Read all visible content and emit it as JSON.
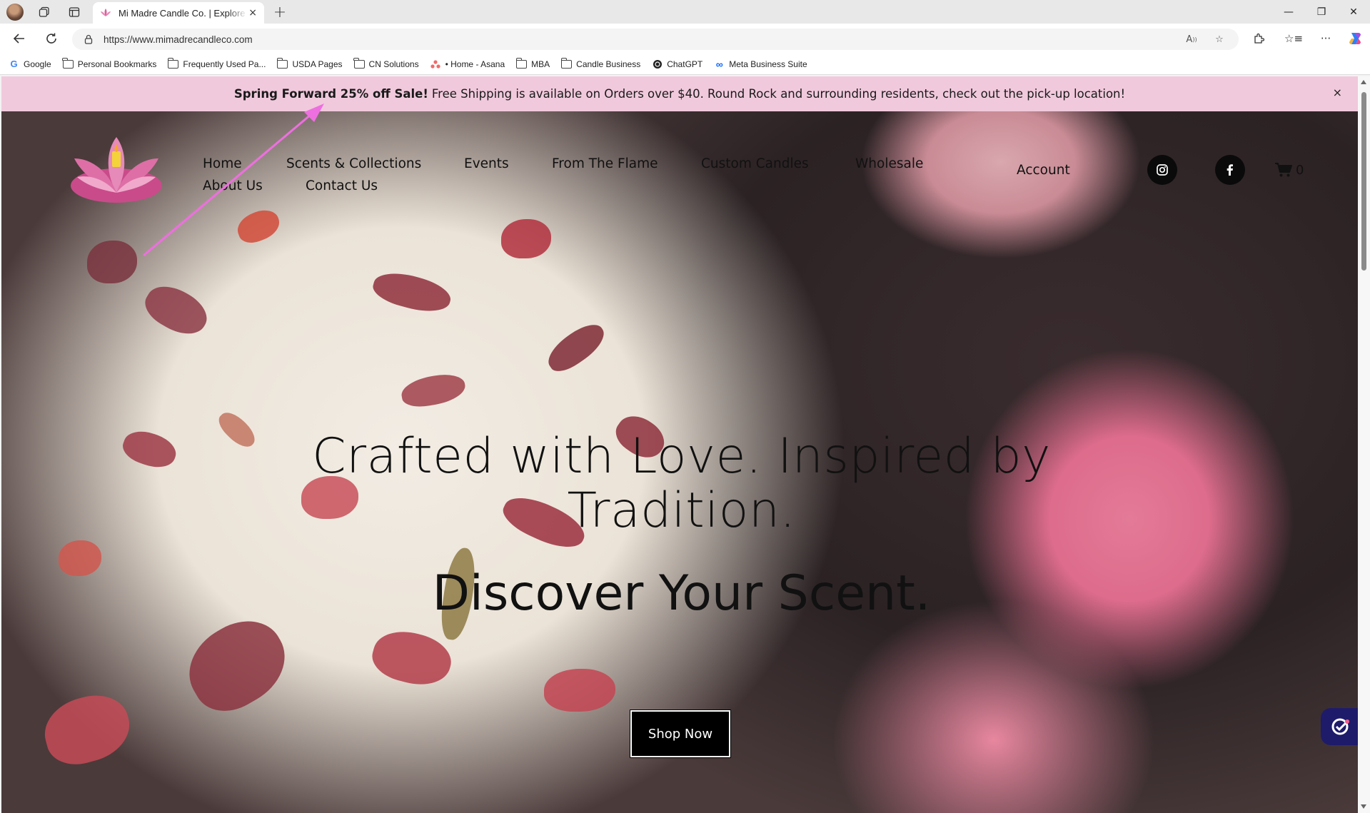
{
  "browser": {
    "tab": {
      "title": "Mi Madre Candle Co. | Explore Ha",
      "close": "×"
    },
    "new_tab": "+",
    "window_controls": {
      "minimize": "—",
      "restore": "❐",
      "close": "✕"
    },
    "address": {
      "url": "https://www.mimadrecandleco.com"
    },
    "bookmarks": [
      {
        "label": "Google",
        "icon": "google-icon"
      },
      {
        "label": "Personal Bookmarks",
        "icon": "folder-icon"
      },
      {
        "label": "Frequently Used Pa...",
        "icon": "folder-icon"
      },
      {
        "label": "USDA Pages",
        "icon": "folder-icon"
      },
      {
        "label": "CN Solutions",
        "icon": "folder-icon"
      },
      {
        "label": "• Home - Asana",
        "icon": "asana-icon"
      },
      {
        "label": "MBA",
        "icon": "folder-icon"
      },
      {
        "label": "Candle Business",
        "icon": "folder-icon"
      },
      {
        "label": "ChatGPT",
        "icon": "chatgpt-icon"
      },
      {
        "label": "Meta Business Suite",
        "icon": "meta-icon"
      }
    ]
  },
  "promo": {
    "bold": "Spring Forward 25% off Sale!",
    "text": "Free Shipping is available on Orders over $40. Round Rock and surrounding residents, check out the pick-up location!",
    "close": "×"
  },
  "nav": {
    "home": "Home",
    "scents": "Scents & Collections",
    "events": "Events",
    "flame": "From The Flame",
    "custom": "Custom Candles",
    "wholesale": "Wholesale",
    "about": "About Us",
    "contact": "Contact Us",
    "account": "Account",
    "cart_count": "0"
  },
  "hero": {
    "heading": "Crafted with Love. Inspired by Tradition.",
    "subheading": "Discover Your Scent.",
    "cta": "Shop Now"
  },
  "colors": {
    "promo_bg": "#f1c9dc",
    "annotation_arrow": "#ee6fe0",
    "cta_bg": "#000000"
  }
}
